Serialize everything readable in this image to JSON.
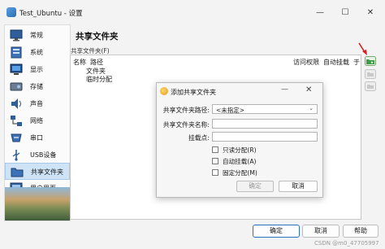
{
  "window": {
    "title": "Test_Ubuntu - 设置"
  },
  "sidebar": {
    "items": [
      {
        "label": "常规",
        "icon": "monitor-icon"
      },
      {
        "label": "系统",
        "icon": "chip-icon"
      },
      {
        "label": "显示",
        "icon": "display-icon"
      },
      {
        "label": "存储",
        "icon": "disk-icon"
      },
      {
        "label": "声音",
        "icon": "speaker-icon"
      },
      {
        "label": "网络",
        "icon": "network-icon"
      },
      {
        "label": "串口",
        "icon": "serial-icon"
      },
      {
        "label": "USB设备",
        "icon": "usb-icon"
      },
      {
        "label": "共享文件夹",
        "icon": "folder-icon"
      },
      {
        "label": "用户界面",
        "icon": "ui-icon"
      }
    ],
    "active_index": 8
  },
  "main": {
    "title": "共享文件夹",
    "group_label": "共享文件夹(F)",
    "columns": {
      "name": "名称",
      "path": "路径",
      "access": "访问权限",
      "automount": "自动挂载",
      "at": "于"
    },
    "rows": [
      "文件夹",
      "临时分配"
    ]
  },
  "dialog": {
    "title": "添加共享文件夹",
    "path_label": "共享文件夹路径:",
    "path_value": "<未指定>",
    "name_label": "共享文件夹名称:",
    "name_value": "",
    "mount_label": "挂载点:",
    "mount_value": "",
    "checkboxes": [
      {
        "label": "只读分配(R)",
        "checked": false
      },
      {
        "label": "自动挂载(A)",
        "checked": false
      },
      {
        "label": "固定分配(M)",
        "checked": false
      }
    ],
    "ok_label": "确定",
    "cancel_label": "取消"
  },
  "footer": {
    "ok_label": "确定",
    "cancel_label": "取消",
    "help_label": "帮助"
  },
  "watermark": "CSDN @m0_47705997"
}
